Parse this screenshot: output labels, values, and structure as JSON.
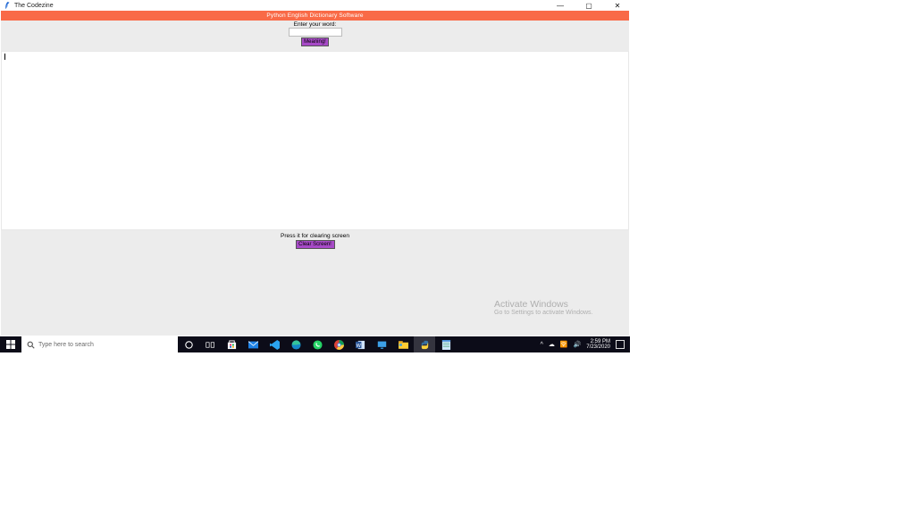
{
  "window": {
    "title": "The Codezine",
    "minimize": "—",
    "maximize": "▢",
    "close": "✕"
  },
  "app": {
    "header": "Python English Dictionary Software",
    "enter_label": "Enter your word:",
    "word_value": "",
    "meaning_btn": "Meaning!",
    "clear_label": "Press it for clearing screen",
    "clear_btn": "Clear Screen!"
  },
  "watermark": {
    "line1": "Activate Windows",
    "line2": "Go to Settings to activate Windows."
  },
  "taskbar": {
    "search_placeholder": "Type here to search",
    "chevron": "^",
    "cloud": "☁",
    "wifi": "🛜",
    "speaker": "🔊",
    "time": "2:59 PM",
    "date": "7/23/2020"
  },
  "icons": {
    "start": "start-icon",
    "search": "search-icon",
    "cortana": "cortana-icon",
    "taskview": "taskview-icon",
    "store": "store-icon",
    "mail": "mail-icon",
    "vscode": "vscode-icon",
    "edge": "edge-icon",
    "whatsapp": "whatsapp-icon",
    "chrome": "chrome-icon",
    "word": "word-icon",
    "monitor": "monitor-icon",
    "explorer": "explorer-icon",
    "python": "python-icon",
    "notepad": "notepad-icon"
  }
}
